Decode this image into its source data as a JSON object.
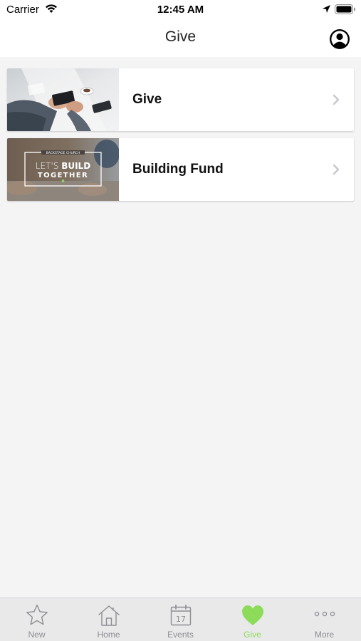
{
  "status_bar": {
    "carrier": "Carrier",
    "time": "12:45 AM",
    "icons": [
      "wifi-icon",
      "location-icon",
      "battery-icon"
    ]
  },
  "nav": {
    "title": "Give",
    "right_icon": "profile-icon"
  },
  "cards": [
    {
      "label": "Give",
      "thumbnail": "hands-with-phone-photo"
    },
    {
      "label": "Building Fund",
      "thumbnail": "lets-build-together-photo",
      "thumbnail_text": {
        "top": "BACKSTAGE CHURCH",
        "line1_light": "LET'S",
        "line1_bold": "BUILD",
        "line2": "TOGETHER"
      }
    }
  ],
  "tab_bar": {
    "active_color": "#8cdc5a",
    "inactive_color": "#8e8e93",
    "tabs": [
      {
        "label": "New",
        "icon": "star-icon"
      },
      {
        "label": "Home",
        "icon": "home-icon"
      },
      {
        "label": "Events",
        "icon": "calendar-icon",
        "calendar_day": "17"
      },
      {
        "label": "Give",
        "icon": "heart-icon",
        "active": true
      },
      {
        "label": "More",
        "icon": "more-icon"
      }
    ]
  }
}
